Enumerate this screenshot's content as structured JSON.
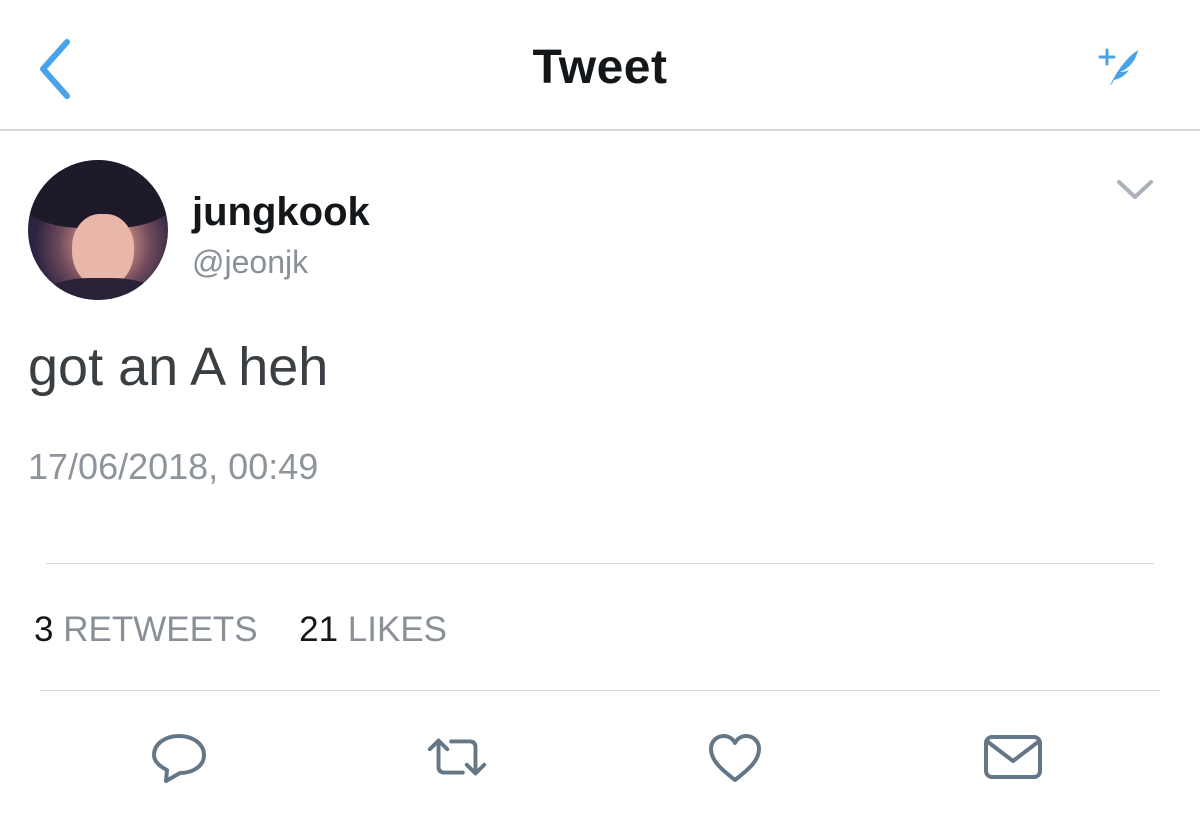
{
  "header": {
    "title": "Tweet",
    "back_icon": "chevron-left-icon",
    "compose_icon": "compose-feather-icon",
    "accent_color": "#4aa3e8"
  },
  "tweet": {
    "author": {
      "display_name": "jungkook",
      "handle": "@jeonjk"
    },
    "text": "got an A heh",
    "timestamp": "17/06/2018, 00:49"
  },
  "stats": {
    "retweets_count": "3",
    "retweets_label": "RETWEETS",
    "likes_count": "21",
    "likes_label": "LIKES"
  },
  "actions": [
    "reply-icon",
    "retweet-icon",
    "like-icon",
    "message-icon"
  ]
}
